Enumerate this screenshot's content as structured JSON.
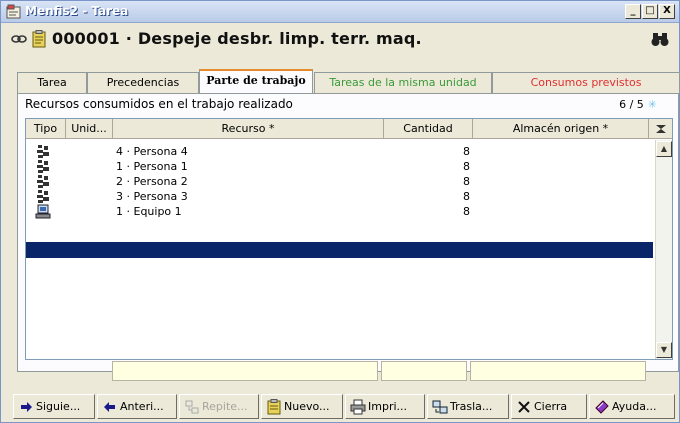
{
  "window": {
    "title": "Menfis2 - Tarea",
    "controls": {
      "minimize": "_",
      "maximize": "□",
      "close": "X"
    }
  },
  "header": {
    "code_title": "000001 · Despeje desbr. limp. terr. maq."
  },
  "tabs": [
    {
      "label": "Tarea",
      "color": "#000000",
      "active": false
    },
    {
      "label": "Precedencias",
      "color": "#000000",
      "active": false
    },
    {
      "label": "Parte de trabajo",
      "color": "#000000",
      "active": true
    },
    {
      "label": "Tareas de la misma unidad",
      "color": "#3a9a3a",
      "active": false
    },
    {
      "label": "Consumos previstos",
      "color": "#e03030",
      "active": false
    }
  ],
  "section": {
    "title": "Recursos consumidos en el trabajo realizado",
    "counter": "6 / 5",
    "counter_star": "✳"
  },
  "grid": {
    "columns": [
      "Tipo",
      "Unid...",
      "Recurso *",
      "Cantidad",
      "Almacén origen *"
    ],
    "rows": [
      {
        "type_icon": "persona-icon",
        "recurso": "4 · Persona 4",
        "cantidad": "8"
      },
      {
        "type_icon": "persona-icon",
        "recurso": "1 · Persona 1",
        "cantidad": "8"
      },
      {
        "type_icon": "persona-icon",
        "recurso": "2 · Persona 2",
        "cantidad": "8"
      },
      {
        "type_icon": "persona-icon",
        "recurso": "3 · Persona 3",
        "cantidad": "8"
      },
      {
        "type_icon": "equipo-icon",
        "recurso": "1 · Equipo 1",
        "cantidad": "8"
      }
    ]
  },
  "buttons": [
    {
      "label": "Siguie...",
      "icon": "arrow-right-icon",
      "enabled": true
    },
    {
      "label": "Anteri...",
      "icon": "arrow-left-icon",
      "enabled": true
    },
    {
      "label": "Repite...",
      "icon": "repeat-icon",
      "enabled": false
    },
    {
      "label": "Nuevo...",
      "icon": "new-doc-icon",
      "enabled": true
    },
    {
      "label": "Impri...",
      "icon": "printer-icon",
      "enabled": true
    },
    {
      "label": "Trasla...",
      "icon": "move-icon",
      "enabled": true
    },
    {
      "label": "Cierra",
      "icon": "close-x-icon",
      "enabled": true
    },
    {
      "label": "Ayuda...",
      "icon": "help-book-icon",
      "enabled": true
    }
  ],
  "colors": {
    "selection": "#0a246a",
    "tab_active_accent": "#e68b2c",
    "total_field_bg": "#ffffe1"
  }
}
